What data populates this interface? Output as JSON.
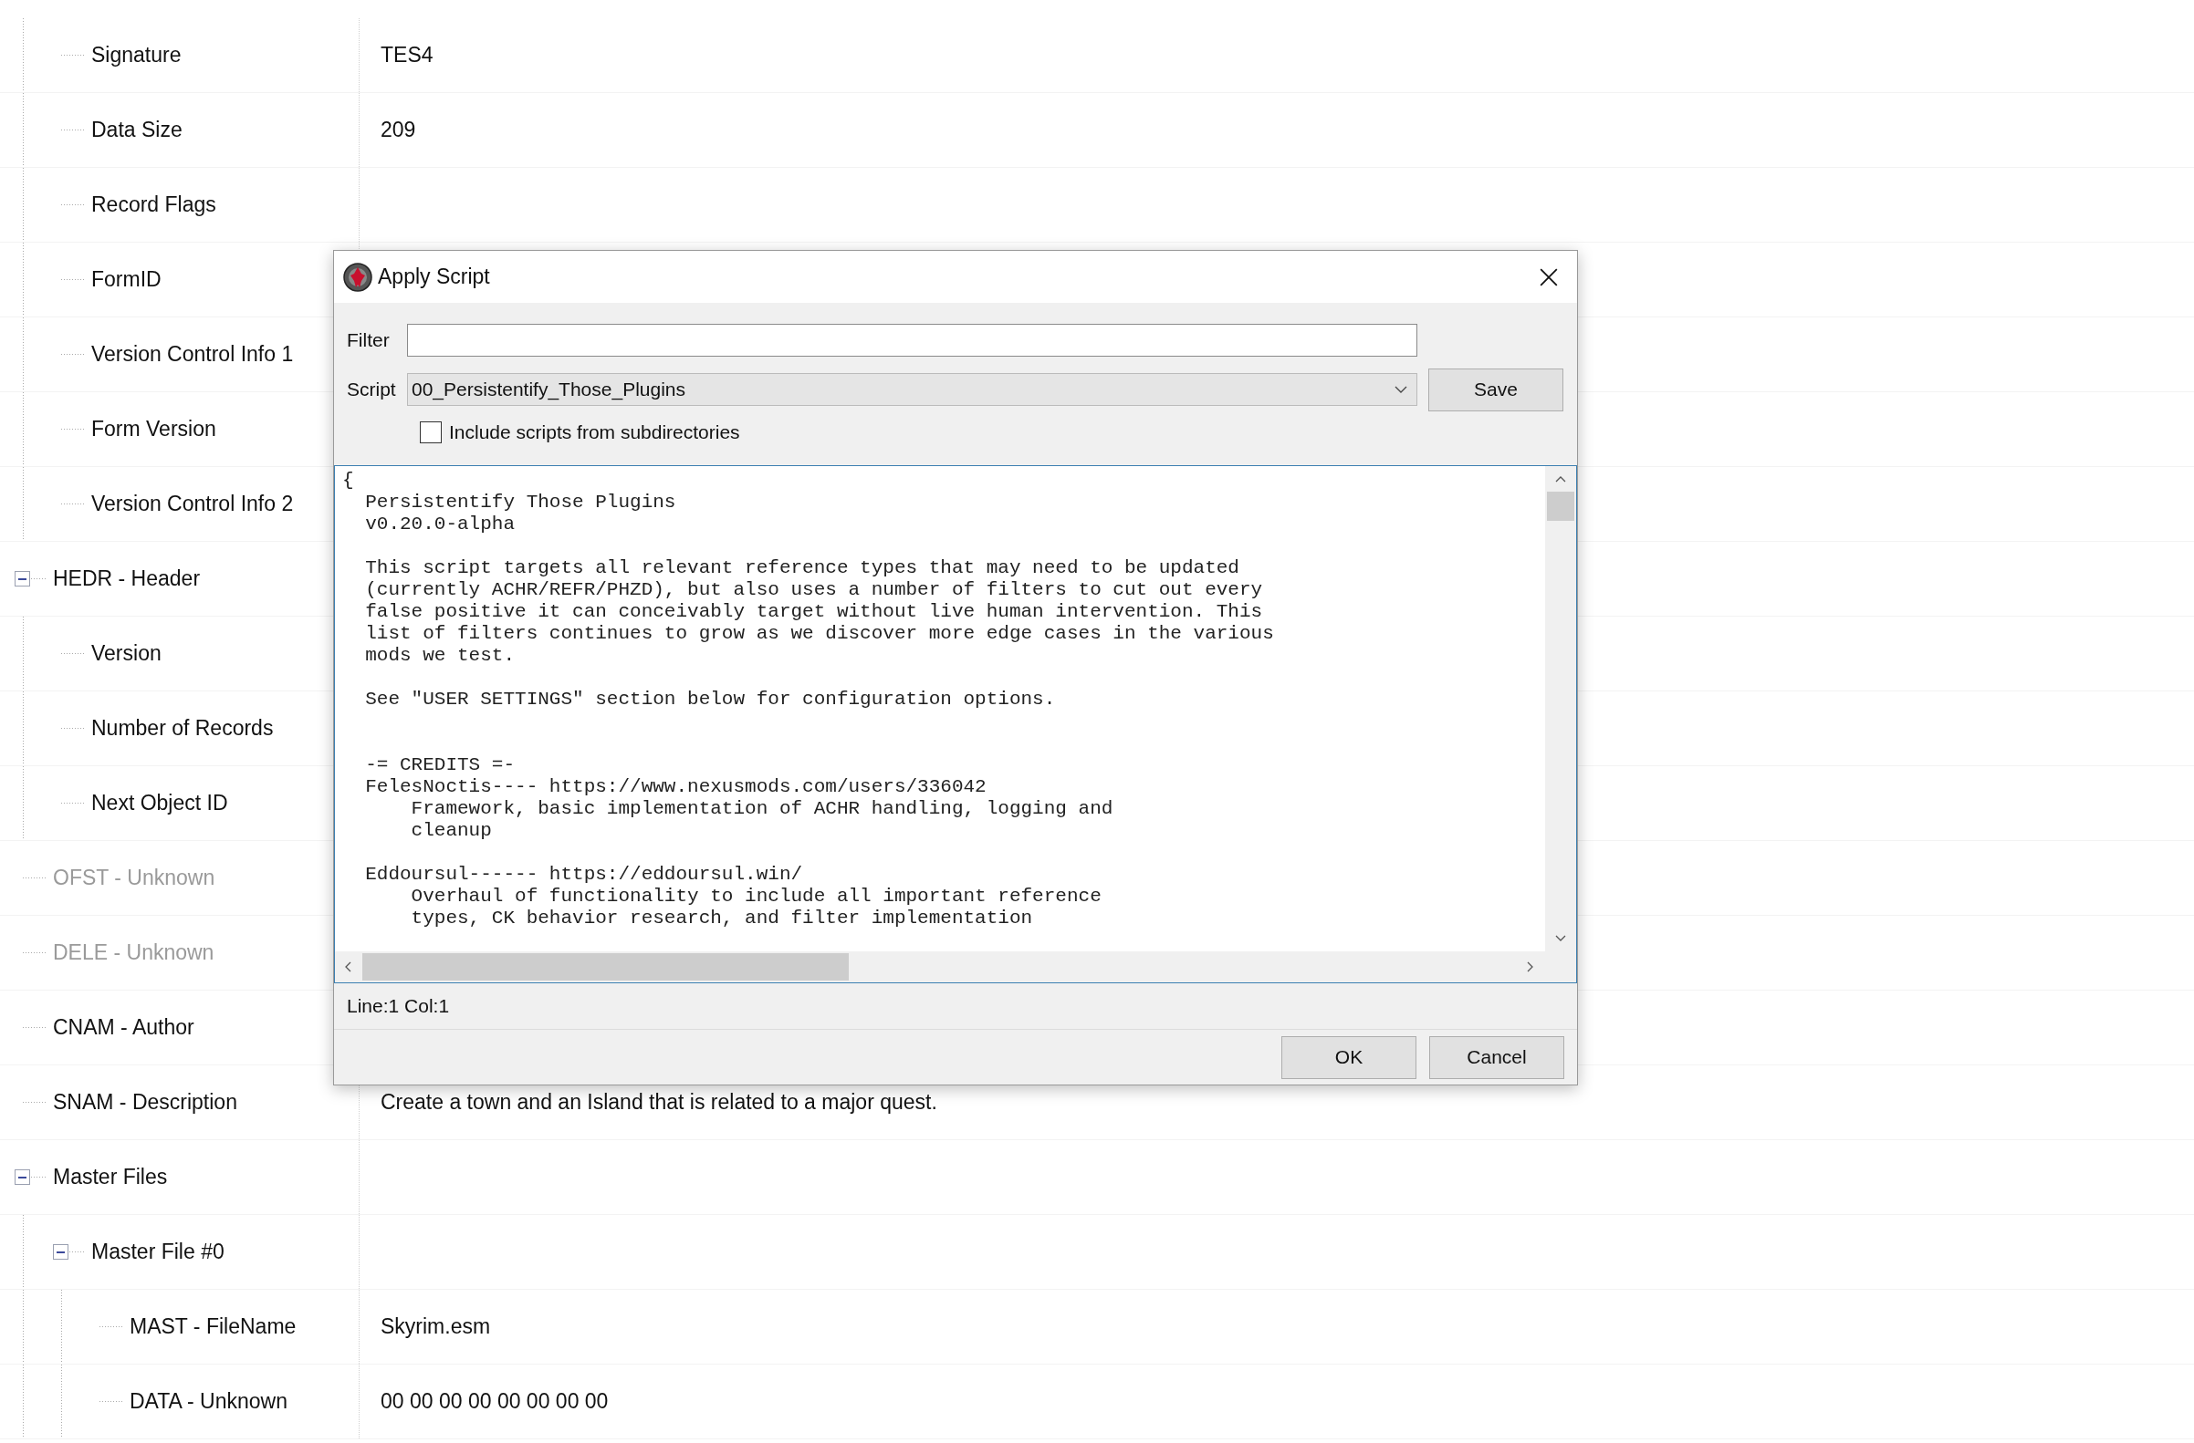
{
  "tree": [
    {
      "children": [
        {
          "label": "Signature",
          "value": "TES4"
        },
        {
          "label": "Data Size",
          "value": "209"
        },
        {
          "label": "Record Flags"
        },
        {
          "label": "FormID"
        },
        {
          "label": "Version Control Info 1"
        },
        {
          "label": "Form Version"
        },
        {
          "label": "Version Control Info 2"
        }
      ]
    },
    {
      "label": "HEDR - Header",
      "expanded": true,
      "children": [
        {
          "label": "Version"
        },
        {
          "label": "Number of Records"
        },
        {
          "label": "Next Object ID"
        }
      ]
    },
    {
      "label": "OFST - Unknown",
      "disabled": true
    },
    {
      "label": "DELE - Unknown",
      "disabled": true
    },
    {
      "label": "CNAM - Author"
    },
    {
      "label": "SNAM - Description",
      "value": "Create a town and an Island that is related to a major quest."
    },
    {
      "label": "Master Files",
      "expanded": true,
      "children": [
        {
          "label": "Master File #0",
          "expanded": true,
          "children": [
            {
              "label": "MAST - FileName",
              "value": "Skyrim.esm"
            },
            {
              "label": "DATA - Unknown",
              "value": "00 00 00 00 00 00 00 00"
            }
          ]
        }
      ]
    }
  ],
  "dialog": {
    "title": "Apply Script",
    "filter_label": "Filter",
    "script_label": "Script",
    "script_value": "00_Persistentify_Those_Plugins",
    "save_button": "Save",
    "include_subdirs": {
      "label": "Include scripts from subdirectories",
      "checked": false
    },
    "editor_text": "{\n  Persistentify Those Plugins\n  v0.20.0-alpha\n\n  This script targets all relevant reference types that may need to be updated\n  (currently ACHR/REFR/PHZD), but also uses a number of filters to cut out every\n  false positive it can conceivably target without live human intervention. This\n  list of filters continues to grow as we discover more edge cases in the various\n  mods we test.\n\n  See \"USER SETTINGS\" section below for configuration options.\n\n\n  -= CREDITS =-\n  FelesNoctis---- https://www.nexusmods.com/users/336042\n      Framework, basic implementation of ACHR handling, logging and\n      cleanup\n\n  Eddoursul------ https://eddoursul.win/\n      Overhaul of functionality to include all important reference\n      types, CK behavior research, and filter implementation",
    "status": "Line:1 Col:1",
    "buttons": [
      "OK",
      "Cancel"
    ]
  }
}
